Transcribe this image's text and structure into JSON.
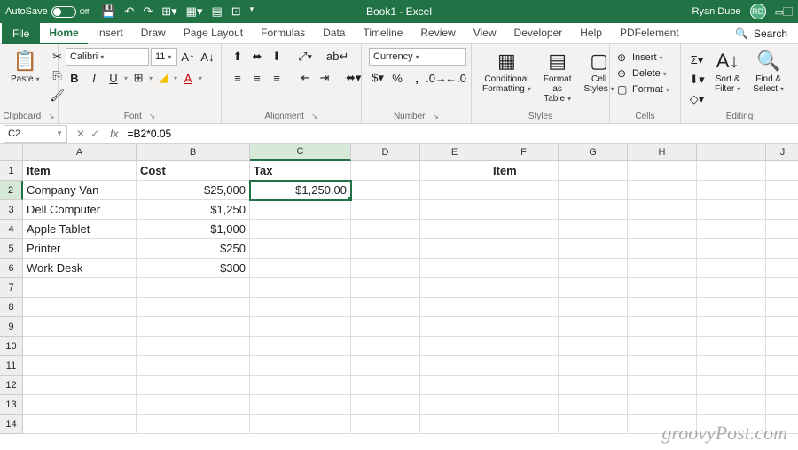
{
  "titlebar": {
    "autosave_label": "AutoSave",
    "autosave_state": "Off",
    "title": "Book1 - Excel",
    "user_name": "Ryan Dube",
    "user_initials": "RD"
  },
  "tabs": {
    "file": "File",
    "items": [
      "Home",
      "Insert",
      "Draw",
      "Page Layout",
      "Formulas",
      "Data",
      "Timeline",
      "Review",
      "View",
      "Developer",
      "Help",
      "PDFelement"
    ],
    "active": "Home",
    "search": "Search"
  },
  "ribbon": {
    "clipboard": {
      "paste": "Paste",
      "label": "Clipboard"
    },
    "font": {
      "name": "Calibri",
      "size": "11",
      "label": "Font"
    },
    "alignment": {
      "label": "Alignment"
    },
    "number": {
      "format": "Currency",
      "label": "Number"
    },
    "styles": {
      "cond": "Conditional\nFormatting",
      "fat": "Format as\nTable",
      "cell": "Cell\nStyles",
      "label": "Styles"
    },
    "cells": {
      "insert": "Insert",
      "delete": "Delete",
      "format": "Format",
      "label": "Cells"
    },
    "editing": {
      "sort": "Sort &\nFilter",
      "find": "Find &\nSelect",
      "label": "Editing"
    }
  },
  "formulabar": {
    "cell_ref": "C2",
    "formula": "=B2*0.05"
  },
  "grid": {
    "columns": [
      {
        "letter": "A",
        "width": 128
      },
      {
        "letter": "B",
        "width": 128
      },
      {
        "letter": "C",
        "width": 114
      },
      {
        "letter": "D",
        "width": 78
      },
      {
        "letter": "E",
        "width": 78
      },
      {
        "letter": "F",
        "width": 78
      },
      {
        "letter": "G",
        "width": 78
      },
      {
        "letter": "H",
        "width": 78
      },
      {
        "letter": "I",
        "width": 78
      },
      {
        "letter": "J",
        "width": 38
      }
    ],
    "active_col": "C",
    "active_row": 2,
    "num_rows": 14,
    "data": {
      "A1": "Item",
      "B1": "Cost",
      "C1": "Tax",
      "F1": "Item",
      "A2": "Company Van",
      "B2": "$25,000",
      "C2": "$1,250.00",
      "A3": "Dell Computer",
      "B3": "$1,250",
      "A4": "Apple Tablet",
      "B4": "$1,000",
      "A5": "Printer",
      "B5": "$250",
      "A6": "Work Desk",
      "B6": "$300"
    }
  },
  "watermark": "groovyPost.com"
}
